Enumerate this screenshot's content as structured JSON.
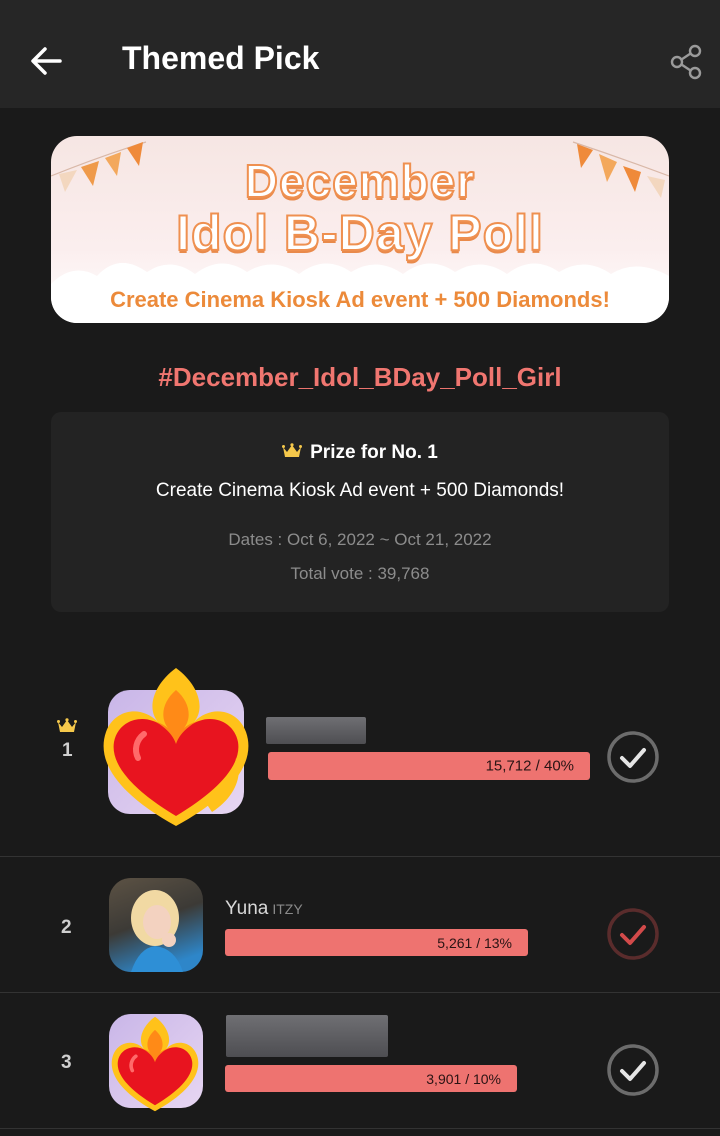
{
  "header": {
    "title": "Themed Pick"
  },
  "banner": {
    "line1": "December",
    "line2": "Idol B-Day Poll",
    "subtitle": "Create Cinema Kiosk Ad event + 500 Diamonds!"
  },
  "hashtag": "#December_Idol_BDay_Poll_Girl",
  "prize": {
    "heading": "Prize for No. 1",
    "description": "Create Cinema Kiosk Ad event + 500 Diamonds!",
    "dates": "Dates : Oct 6, 2022 ~ Oct 21, 2022",
    "total_vote": "Total vote : 39,768"
  },
  "entries": [
    {
      "rank": "1",
      "name": "",
      "group": "",
      "votes_label": "15,712 / 40%",
      "share": 0.4
    },
    {
      "rank": "2",
      "name": "Yuna",
      "group": "ITZY",
      "votes_label": "5,261 / 13%",
      "share": 0.13
    },
    {
      "rank": "3",
      "name": "",
      "group": "",
      "votes_label": "3,901 / 10%",
      "share": 0.1
    }
  ],
  "colors": {
    "accent": "#ee7370",
    "hashtag": "#f07670",
    "background": "#1a1a1a",
    "header": "#262626"
  },
  "icons": [
    "arrow-left-icon",
    "share-icon",
    "crown-icon",
    "check-circle-icon",
    "fire-heart-icon"
  ]
}
